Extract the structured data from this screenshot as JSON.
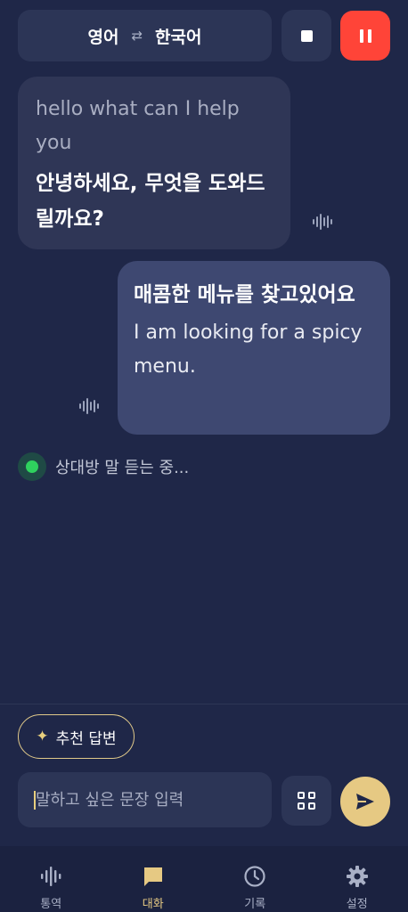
{
  "header": {
    "source_lang": "영어",
    "target_lang": "한국어",
    "swap_icon": "swap-arrows-icon",
    "stop_icon": "stop-icon",
    "pause_icon": "pause-icon",
    "pause_color": "#ff4438"
  },
  "messages": [
    {
      "side": "left",
      "original": "hello what can I help you",
      "translation": "안녕하세요, 무엇을 도와드릴까요?"
    },
    {
      "side": "right",
      "translation": "매콤한 메뉴를 찾고있어요",
      "original": "I am looking for a spicy menu."
    }
  ],
  "status": {
    "text": "상대방 말 듣는 중...",
    "color": "#2fd15e"
  },
  "suggest": {
    "label": "추천 답변",
    "icon": "sparkle-icon"
  },
  "input": {
    "placeholder": "말하고 싶은 문장 입력",
    "value": ""
  },
  "nav": {
    "items": [
      {
        "label": "통역",
        "icon": "waveform-icon"
      },
      {
        "label": "대화",
        "icon": "chat-bubble-icon",
        "active": true
      },
      {
        "label": "기록",
        "icon": "clock-icon"
      },
      {
        "label": "설정",
        "icon": "gear-icon"
      }
    ],
    "active_color": "#e6c983"
  }
}
